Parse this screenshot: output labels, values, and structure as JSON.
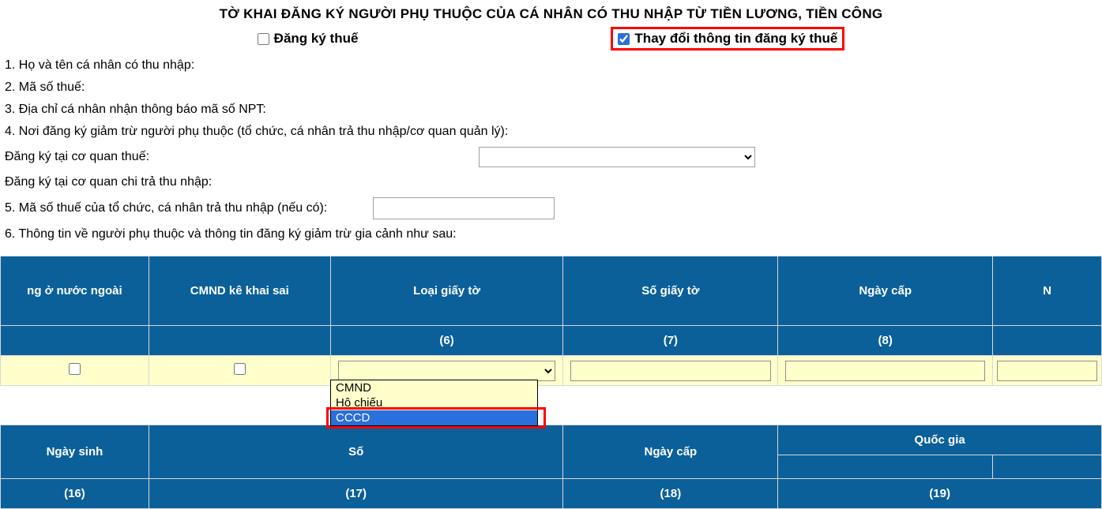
{
  "title": "TỜ KHAI ĐĂNG KÝ NGƯỜI PHỤ THUỘC CỦA CÁ NHÂN CÓ THU NHẬP TỪ TIỀN LƯƠNG, TIỀN CÔNG",
  "checkboxes": {
    "register": {
      "label": "Đăng ký thuế",
      "checked": false
    },
    "change": {
      "label": "Thay đổi thông tin đăng ký thuế",
      "checked": true
    }
  },
  "lines": {
    "l1": "1. Họ và tên cá nhân có thu nhập:",
    "l2": "2. Mã số thuế:",
    "l3": "3. Địa chỉ cá nhân nhận thông báo mã số NPT:",
    "l4": "4. Nơi đăng ký giảm trừ người phụ thuộc (tổ chức, cá nhân trả thu nhập/cơ quan quản lý):",
    "reg_agency": "Đăng ký tại cơ quan thuế:",
    "reg_payer": "Đăng ký tại cơ quan chi trả thu nhập:",
    "l5": "5. Mã số thuế của tổ chức, cá nhân trả thu nhập (nếu có):",
    "l6": "6. Thông tin về người phụ thuộc và thông tin đăng ký giảm trừ gia cảnh như sau:"
  },
  "fields": {
    "agency_select": "",
    "payer_tax": ""
  },
  "table": {
    "headers1": {
      "c_a": "ng ở nước ngoài",
      "c_b": "CMND kê khai sai",
      "c_c": "Loại giấy tờ",
      "c_d": "Số giấy tờ",
      "c_e": "Ngày cấp",
      "c_f": "N"
    },
    "nums1": {
      "n6": "(6)",
      "n7": "(7)",
      "n8": "(8)"
    },
    "row1": {
      "foreign": false,
      "wrong_cmnd": false,
      "doc_type": "",
      "doc_no": "",
      "issue_date": "",
      "extra": ""
    },
    "headers2": {
      "c_a": "Ngày sinh",
      "c_b": "Số",
      "c_c": "Ngày cấp",
      "c_d": "Quốc gia"
    },
    "nums2": {
      "n16": "(16)",
      "n17": "(17)",
      "n18": "(18)",
      "n19": "(19)"
    }
  },
  "dropdown": {
    "opt1": "CMND",
    "opt2": "Hô chiếu",
    "opt3": "CCCD"
  }
}
